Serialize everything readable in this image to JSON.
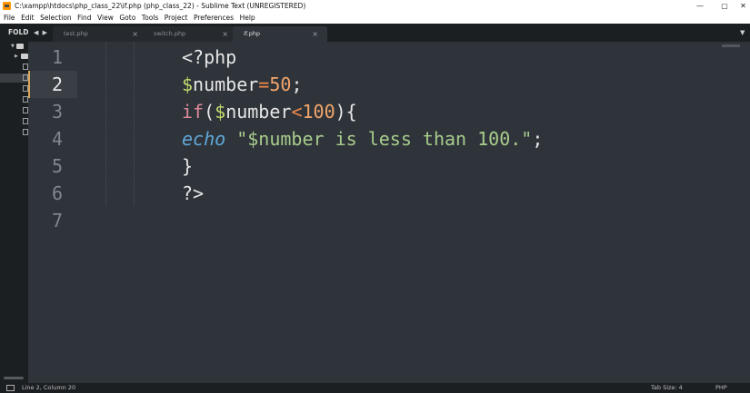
{
  "window": {
    "title": "C:\\xampp\\htdocs\\php_class_22\\if.php (php_class_22) - Sublime Text (UNREGISTERED)",
    "minimize": "—",
    "maximize": "▢",
    "close": "✕"
  },
  "menu": [
    "File",
    "Edit",
    "Selection",
    "Find",
    "View",
    "Goto",
    "Tools",
    "Project",
    "Preferences",
    "Help"
  ],
  "sidebar": {
    "label": "FOLD",
    "nav": "◀ ▶"
  },
  "tabs": [
    {
      "label": "test.php",
      "active": false
    },
    {
      "label": "switch.php",
      "active": false
    },
    {
      "label": "if.php",
      "active": true
    }
  ],
  "tab_close": "×",
  "tab_dropdown": "▼",
  "editor": {
    "current_line": 2,
    "line_numbers": [
      "1",
      "2",
      "3",
      "4",
      "5",
      "6",
      "7"
    ],
    "code": {
      "l1": {
        "text": "<?php"
      },
      "l2": {
        "dollar": "$",
        "var": "number",
        "op": "=",
        "num": "50",
        "end": ";"
      },
      "l3": {
        "kw": "if",
        "open": "(",
        "dollar": "$",
        "var": "number",
        "op": "<",
        "num": "100",
        "close": "){"
      },
      "l4": {
        "echo": "echo",
        "str": "\"$number is less than 100.\"",
        "end": ";"
      },
      "l5": {
        "text": "}"
      },
      "l6": {
        "text": "?>"
      }
    }
  },
  "status": {
    "position": "Line 2, Column 20",
    "tab_size": "Tab Size: 4",
    "syntax": "PHP"
  },
  "colors": {
    "editor_bg": "#2f343a",
    "sidebar_bg": "#1c1f22",
    "dollar": "#c2d96d",
    "operator": "#f0894a",
    "number": "#f3a56a",
    "keyword": "#e08a9a",
    "echo": "#60a8d8",
    "string": "#a8cc8c"
  }
}
